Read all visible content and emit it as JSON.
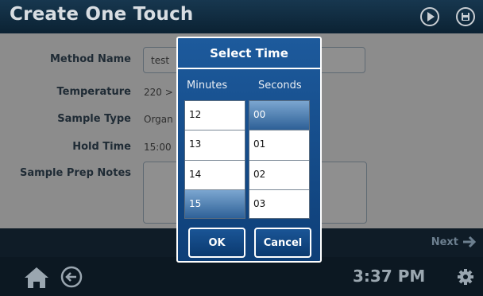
{
  "header": {
    "title": "Create One Touch",
    "icons": [
      "play-icon",
      "save-icon"
    ]
  },
  "form": {
    "method_name": {
      "label": "Method Name",
      "value": "test"
    },
    "temperature": {
      "label": "Temperature",
      "value": "220 >"
    },
    "sample_type": {
      "label": "Sample Type",
      "value": "Organ"
    },
    "hold_time": {
      "label": "Hold Time",
      "value": "15:00"
    },
    "sample_prep_notes": {
      "label": "Sample Prep Notes",
      "value": ""
    }
  },
  "footer": {
    "next_label": "Next",
    "clock": "3:37 PM",
    "icons": [
      "home-icon",
      "back-icon",
      "gear-icon"
    ]
  },
  "modal": {
    "title": "Select Time",
    "minutes_header": "Minutes",
    "seconds_header": "Seconds",
    "minutes": [
      "12",
      "13",
      "14",
      "15"
    ],
    "minutes_selected": "15",
    "seconds": [
      "00",
      "01",
      "02",
      "03"
    ],
    "seconds_selected": "00",
    "ok_label": "OK",
    "cancel_label": "Cancel"
  },
  "colors": {
    "modal_blue": "#1d5a9c",
    "selection_blue": "#2d5f96",
    "content_gray": "#8c8c8c"
  }
}
